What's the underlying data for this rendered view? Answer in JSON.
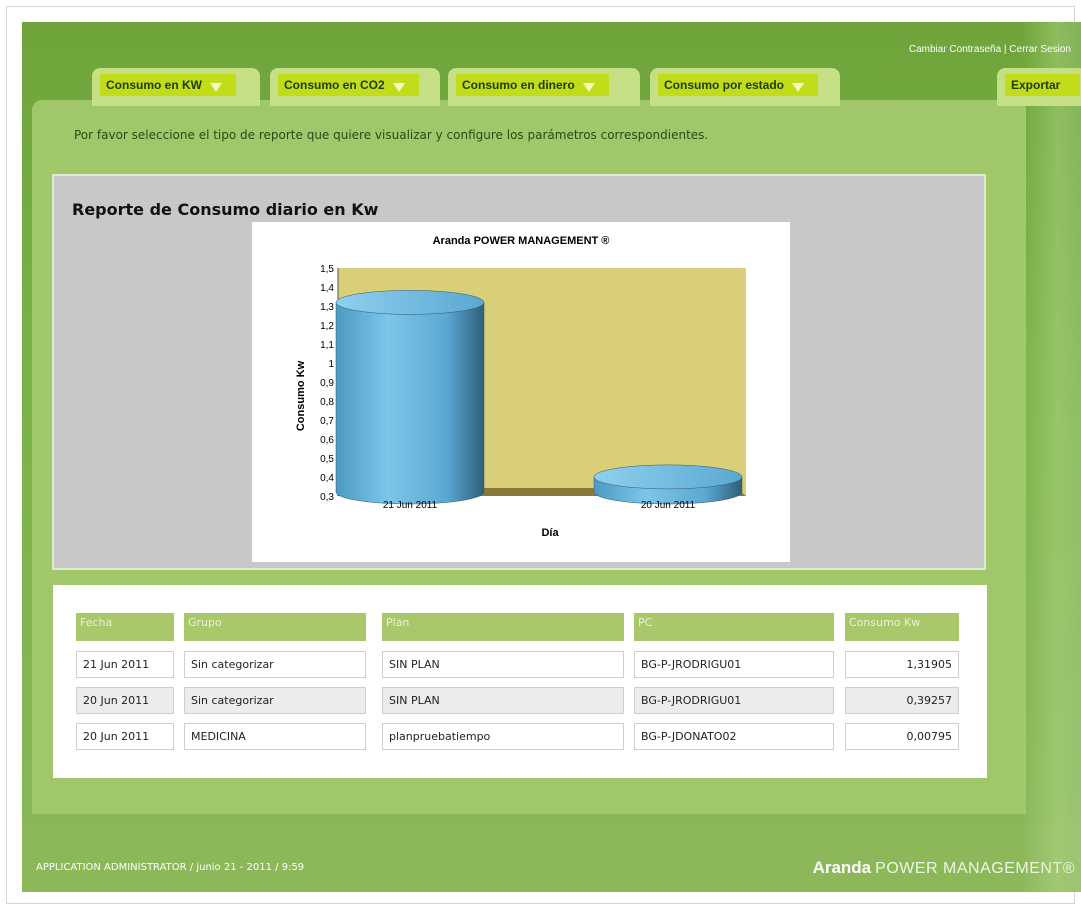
{
  "header": {
    "change_password": "Cambiar Contraseña",
    "separator": "|",
    "logout": "Cerrar Sesion"
  },
  "tabs": [
    {
      "label": "Consumo en KW"
    },
    {
      "label": "Consumo en CO2"
    },
    {
      "label": "Consumo en dinero"
    },
    {
      "label": "Consumo por estado"
    },
    {
      "label": "Exportar"
    }
  ],
  "intro": "Por favor seleccione el tipo de reporte que quiere visualizar y configure los parámetros correspondientes.",
  "report": {
    "title": "Reporte de Consumo diario en Kw"
  },
  "chart_data": {
    "type": "bar",
    "title": "Aranda POWER MANAGEMENT ®",
    "xlabel": "Día",
    "ylabel": "Consumo Kw",
    "categories": [
      "21 Jun 2011",
      "20 Jun 2011"
    ],
    "values": [
      1.31905,
      0.40052
    ],
    "ylim": [
      0.3,
      1.5
    ],
    "yticks": [
      "1,5",
      "1,4",
      "1,3",
      "1,2",
      "1,1",
      "1",
      "0,9",
      "0,8",
      "0,7",
      "0,6",
      "0,5",
      "0,4",
      "0,3"
    ],
    "style": "3d-cylinder",
    "colors": {
      "bar": "#6ab7de",
      "plot_bg": "#d9cf78",
      "floor": "#8a7a3a"
    }
  },
  "table": {
    "headers": [
      "Fecha",
      "Grupo",
      "Plan",
      "PC",
      "Consumo Kw"
    ],
    "rows": [
      [
        "21 Jun 2011",
        "Sin categorizar",
        "SIN PLAN",
        "BG-P-JRODRIGU01",
        "1,31905"
      ],
      [
        "20 Jun 2011",
        "Sin categorizar",
        "SIN PLAN",
        "BG-P-JRODRIGU01",
        "0,39257"
      ],
      [
        "20 Jun 2011",
        "MEDICINA",
        "planpruebatiempo",
        "BG-P-JDONATO02",
        "0,00795"
      ]
    ]
  },
  "footer": {
    "status": "APPLICATION ADMINISTRATOR / junio 21 - 2011 / 9:59",
    "brand_bold": "Aranda",
    "brand_rest": "POWER MANAGEMENT®"
  },
  "colors": {
    "app_green": "#7ab246",
    "tab_label_bg": "#c1dc18",
    "panel_green": "#a0c86a",
    "header_cell": "#a8c86a"
  }
}
